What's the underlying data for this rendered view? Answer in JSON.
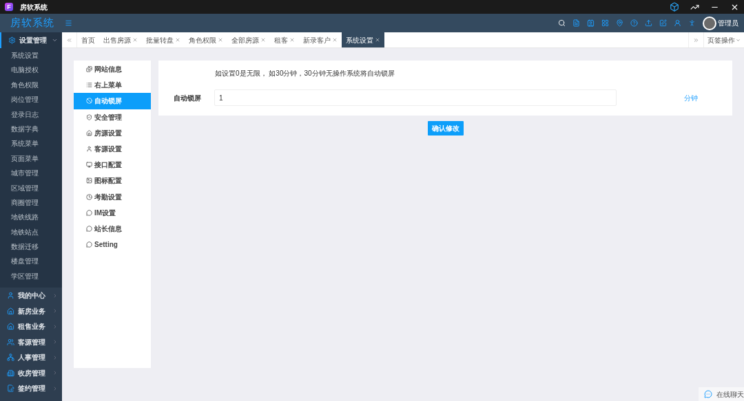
{
  "titlebar": {
    "logo_letter": "F",
    "title": "房软系统"
  },
  "header": {
    "brand": "房软系统",
    "user": "管理员"
  },
  "sidebar": {
    "groups": [
      {
        "label": "设置管理",
        "expanded": true,
        "items": [
          {
            "label": "系统设置",
            "selected": false
          },
          {
            "label": "电脑授权",
            "selected": false
          },
          {
            "label": "角色权限",
            "selected": false
          },
          {
            "label": "岗位管理",
            "selected": false
          },
          {
            "label": "登录日志",
            "selected": false
          },
          {
            "label": "数据字典",
            "selected": false
          },
          {
            "label": "系统菜单",
            "selected": false
          },
          {
            "label": "页面菜单",
            "selected": false
          },
          {
            "label": "城市管理",
            "selected": false
          },
          {
            "label": "区域管理",
            "selected": false
          },
          {
            "label": "商圈管理",
            "selected": false
          },
          {
            "label": "地铁线路",
            "selected": false
          },
          {
            "label": "地铁站点",
            "selected": false
          },
          {
            "label": "数据迁移",
            "selected": false
          },
          {
            "label": "楼盘管理",
            "selected": false
          },
          {
            "label": "学区管理",
            "selected": false
          }
        ]
      },
      {
        "label": "我的中心",
        "expanded": false
      },
      {
        "label": "新房业务",
        "expanded": false
      },
      {
        "label": "租售业务",
        "expanded": false
      },
      {
        "label": "客源管理",
        "expanded": false
      },
      {
        "label": "人事管理",
        "expanded": false
      },
      {
        "label": "收房管理",
        "expanded": false
      },
      {
        "label": "签约管理",
        "expanded": false
      }
    ]
  },
  "tabs": [
    {
      "label": "首页",
      "selected": false,
      "closable": false
    },
    {
      "label": "出售房源",
      "selected": false,
      "closable": true
    },
    {
      "label": "批量转盘",
      "selected": false,
      "closable": true
    },
    {
      "label": "角色权限",
      "selected": false,
      "closable": true
    },
    {
      "label": "全部房源",
      "selected": false,
      "closable": true
    },
    {
      "label": "租客",
      "selected": false,
      "closable": true
    },
    {
      "label": "新录客户",
      "selected": false,
      "closable": true
    },
    {
      "label": "系统设置",
      "selected": true,
      "closable": true
    }
  ],
  "tab_actions": "页签操作",
  "settings_menu": [
    {
      "label": "网站信息",
      "selected": false
    },
    {
      "label": "右上菜单",
      "selected": false
    },
    {
      "label": "自动锁屏",
      "selected": true
    },
    {
      "label": "安全管理",
      "selected": false
    },
    {
      "label": "房源设置",
      "selected": false
    },
    {
      "label": "客源设置",
      "selected": false
    },
    {
      "label": "接口配置",
      "selected": false
    },
    {
      "label": "图标配置",
      "selected": false
    },
    {
      "label": "考勤设置",
      "selected": false
    },
    {
      "label": "IM设置",
      "selected": false
    },
    {
      "label": "站长信息",
      "selected": false
    },
    {
      "label": "Setting",
      "selected": false
    }
  ],
  "form": {
    "hint": "如设置0是无限， 如30分钟，30分钟无操作系统将自动锁屏",
    "field_label": "自动锁屏",
    "value": "1",
    "unit": "分钟",
    "submit": "确认修改"
  },
  "chat_button": "在线聊天"
}
